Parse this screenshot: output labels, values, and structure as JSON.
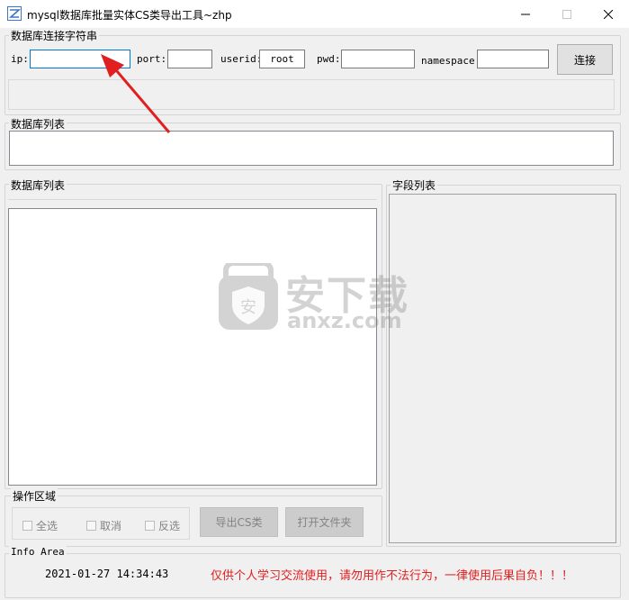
{
  "window": {
    "title": "mysql数据库批量实体CS类导出工具~zhp",
    "minimize_glyph": "—",
    "maximize_glyph": "☐",
    "close_glyph": "✕"
  },
  "connection": {
    "legend": "数据库连接字符串",
    "ip_label": "ip:",
    "ip_value": "",
    "port_label": "port:",
    "port_value": "",
    "userid_label": "userid:",
    "userid_value": "root",
    "pwd_label": "pwd:",
    "pwd_value": "",
    "namespace_label": "namespace:",
    "namespace_value": "",
    "connect_label": "连接"
  },
  "db_list_top": {
    "legend": "数据库列表"
  },
  "db_list_main": {
    "legend": "数据库列表"
  },
  "field_list": {
    "legend": "字段列表"
  },
  "operations": {
    "legend": "操作区域",
    "select_all_label": "全选",
    "cancel_label": "取消",
    "invert_label": "反选",
    "export_label": "导出CS类",
    "open_folder_label": "打开文件夹"
  },
  "info": {
    "legend": "Info Area",
    "timestamp": "2021-01-27 14:34:43",
    "notice": "仅供个人学习交流使用，请勿用作不法行为，一律使用后果自负！！！",
    "notice_color": "#e02020"
  },
  "watermark": {
    "text": "安下载",
    "subtext": "anxz.com"
  },
  "icons": [
    "app-icon",
    "minimize-icon",
    "maximize-icon",
    "close-icon",
    "shield-icon",
    "red-arrow-icon"
  ]
}
